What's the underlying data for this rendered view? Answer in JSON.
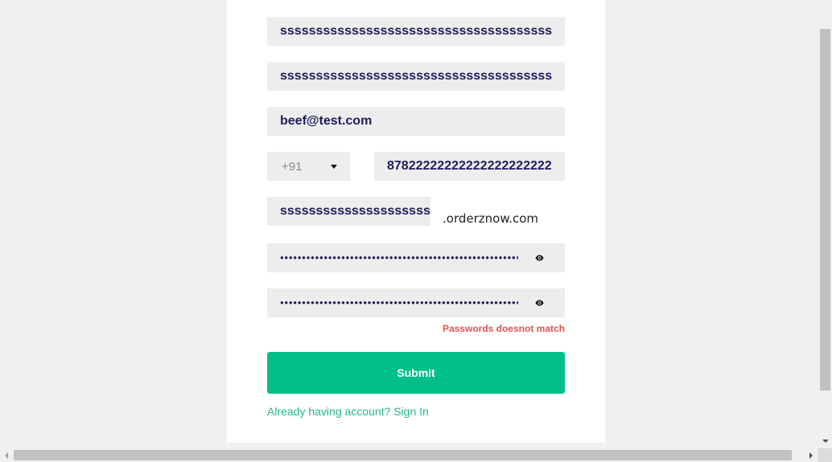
{
  "form": {
    "first_name": {
      "value": "sssssssssssssssssssssssssssssssssssssssssss"
    },
    "last_name": {
      "value": "sssssssssssssssssssssssssssssssssssssssssss"
    },
    "email": {
      "value": "beef@test.com"
    },
    "phone": {
      "country_code": "+91",
      "number": "878222222222222222222222"
    },
    "subdomain": {
      "value": "sssssssssssssssssssssssssss",
      "suffix": ".orderznow.com"
    },
    "password": {
      "masked": "●●●●●●●●●●●●●●●●●●●●●●●●●●●●●●●●●●●●●●●●●●●●●●●●●●●●●●●●●●●"
    },
    "confirm_password": {
      "masked": "●●●●●●●●●●●●●●●●●●●●●●●●●●●●●●●●●●●●●●●●●●●●●●●●●●●●●●●●●●●"
    },
    "error_message": "Passwords doesnot match",
    "submit_label": "Submit",
    "signin_link": "Already having account? Sign In"
  },
  "icons": {
    "dropdown": "caret-down-icon",
    "toggle_password": "eye-icon"
  },
  "colors": {
    "primary": "#00be87",
    "link": "#1fb98a",
    "error": "#e8504f",
    "input_text": "#1c1c5e",
    "input_bg": "#ededed"
  }
}
